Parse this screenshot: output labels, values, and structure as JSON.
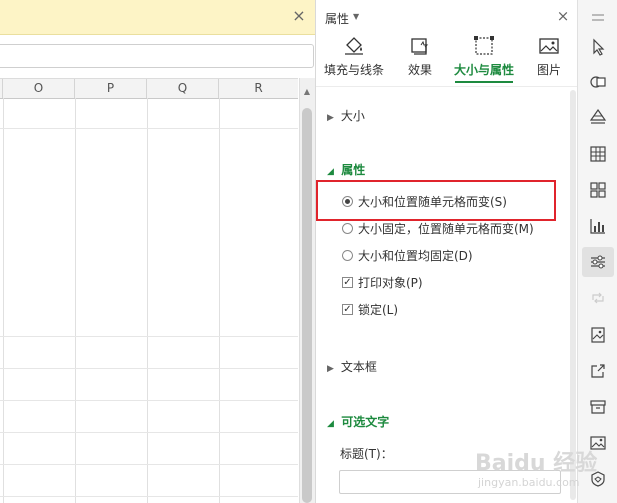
{
  "sheet": {
    "columns": [
      "O",
      "P",
      "Q",
      "R"
    ]
  },
  "pane": {
    "title": "属性",
    "tabs": [
      {
        "label": "填充与线条",
        "icon": "fill-bucket-icon"
      },
      {
        "label": "效果",
        "icon": "effects-icon"
      },
      {
        "label": "大小与属性",
        "icon": "size-properties-icon",
        "active": true
      },
      {
        "label": "图片",
        "icon": "picture-icon"
      }
    ],
    "sections": {
      "size": "大小",
      "properties": "属性",
      "textbox": "文本框",
      "alt_text": "可选文字"
    },
    "options": {
      "move_and_size": "大小和位置随单元格而变(S)",
      "move_no_size": "大小固定，位置随单元格而变(M)",
      "no_move_no_size": "大小和位置均固定(D)",
      "print_object": "打印对象(P)",
      "locked": "锁定(L)"
    },
    "selected_option": "move_and_size",
    "print_object_checked": true,
    "locked_checked": true,
    "title_label": "标题(T)："
  },
  "watermark": {
    "brand": "Baidu 经验",
    "url": "jingyan.baidu.com"
  },
  "colors": {
    "accent": "#1d8a3f",
    "highlight": "#e0242c"
  }
}
